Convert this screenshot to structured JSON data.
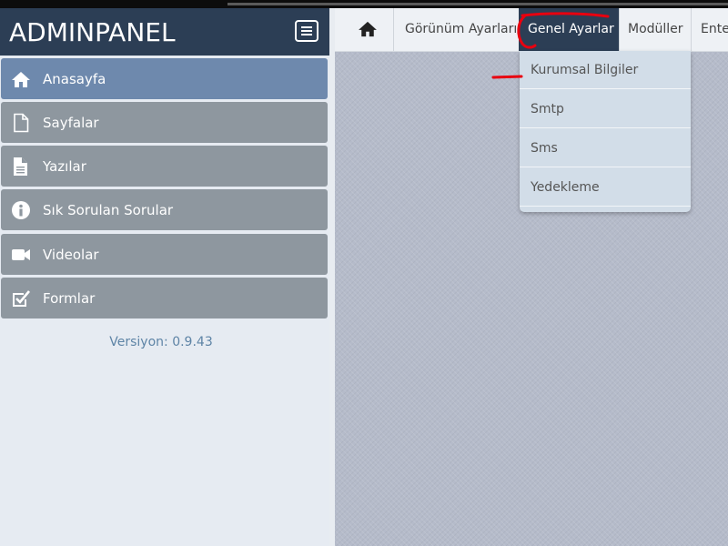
{
  "brand": {
    "title": "ADMINPANEL"
  },
  "sidebar": {
    "items": [
      {
        "label": "Anasayfa",
        "icon": "home-icon",
        "active": true
      },
      {
        "label": "Sayfalar",
        "icon": "file-icon"
      },
      {
        "label": "Yazılar",
        "icon": "document-icon"
      },
      {
        "label": "Sık Sorulan Sorular",
        "icon": "info-icon"
      },
      {
        "label": "Videolar",
        "icon": "video-camera-icon"
      },
      {
        "label": "Formlar",
        "icon": "checkbox-icon"
      }
    ],
    "version": "Versiyon: 0.9.43"
  },
  "navbar": {
    "home_icon": "home-icon",
    "tabs": [
      {
        "label": "Görünüm Ayarları"
      },
      {
        "label": "Genel Ayarlar",
        "active": true
      },
      {
        "label": "Modüller"
      },
      {
        "label": "Ente"
      }
    ]
  },
  "dropdown": {
    "items": [
      {
        "label": "Kurumsal Bilgiler"
      },
      {
        "label": "Smtp"
      },
      {
        "label": "Sms"
      },
      {
        "label": "Yedekleme"
      }
    ]
  },
  "colors": {
    "brand_bg": "#2c3e55",
    "active_menu": "#6e89ad",
    "menu_item": "#8e979f",
    "annotation": "#e8000f"
  }
}
